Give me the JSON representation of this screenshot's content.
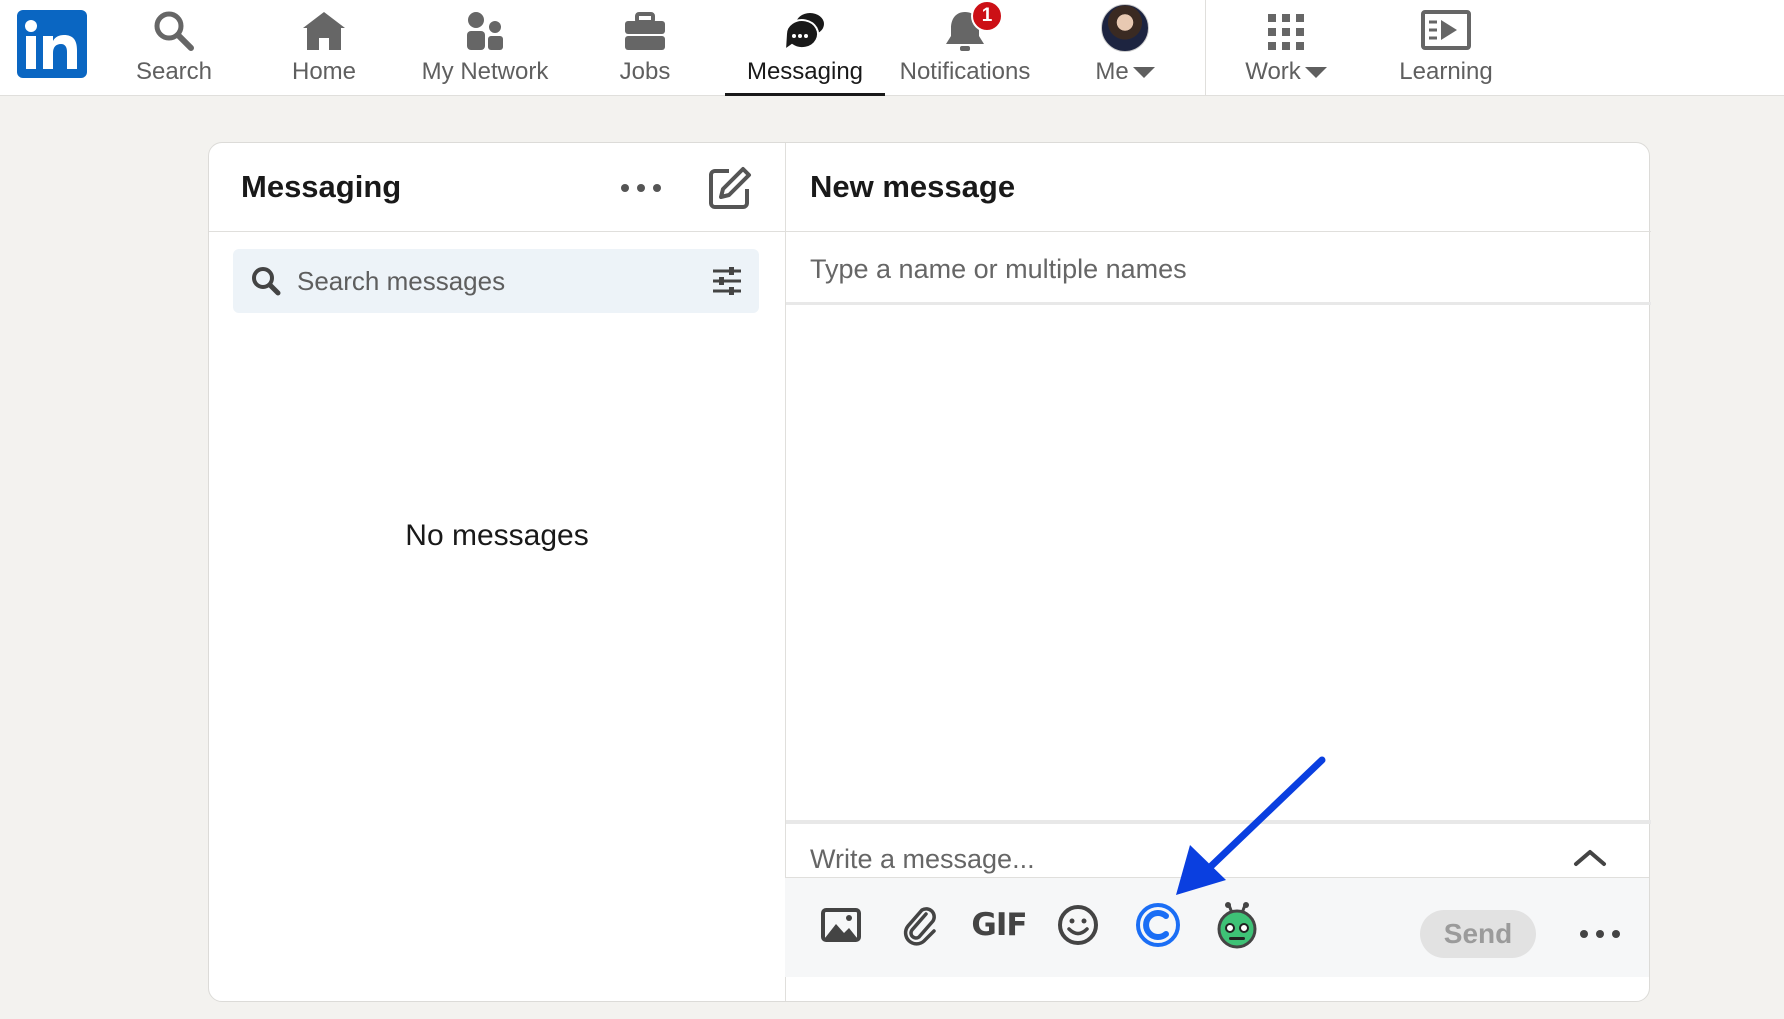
{
  "nav": {
    "items": [
      {
        "label": "Search",
        "icon": "search-icon"
      },
      {
        "label": "Home",
        "icon": "home-icon"
      },
      {
        "label": "My Network",
        "icon": "network-icon"
      },
      {
        "label": "Jobs",
        "icon": "briefcase-icon"
      },
      {
        "label": "Messaging",
        "icon": "messaging-icon",
        "active": true
      },
      {
        "label": "Notifications",
        "icon": "bell-icon",
        "badge": "1"
      },
      {
        "label": "Me",
        "icon": "avatar"
      },
      {
        "label": "Work",
        "icon": "grid-icon"
      },
      {
        "label": "Learning",
        "icon": "learning-icon"
      }
    ]
  },
  "colors": {
    "brand": "#0a66c2",
    "badge": "#cc1016",
    "arrow": "#0a3fe0"
  },
  "messaging": {
    "title": "Messaging",
    "search_placeholder": "Search messages",
    "empty_text": "No messages"
  },
  "new_message": {
    "title": "New message",
    "recipient_placeholder": "Type a name or multiple names",
    "message_placeholder": "Write a message...",
    "gif_label": "GIF",
    "send_label": "Send"
  }
}
